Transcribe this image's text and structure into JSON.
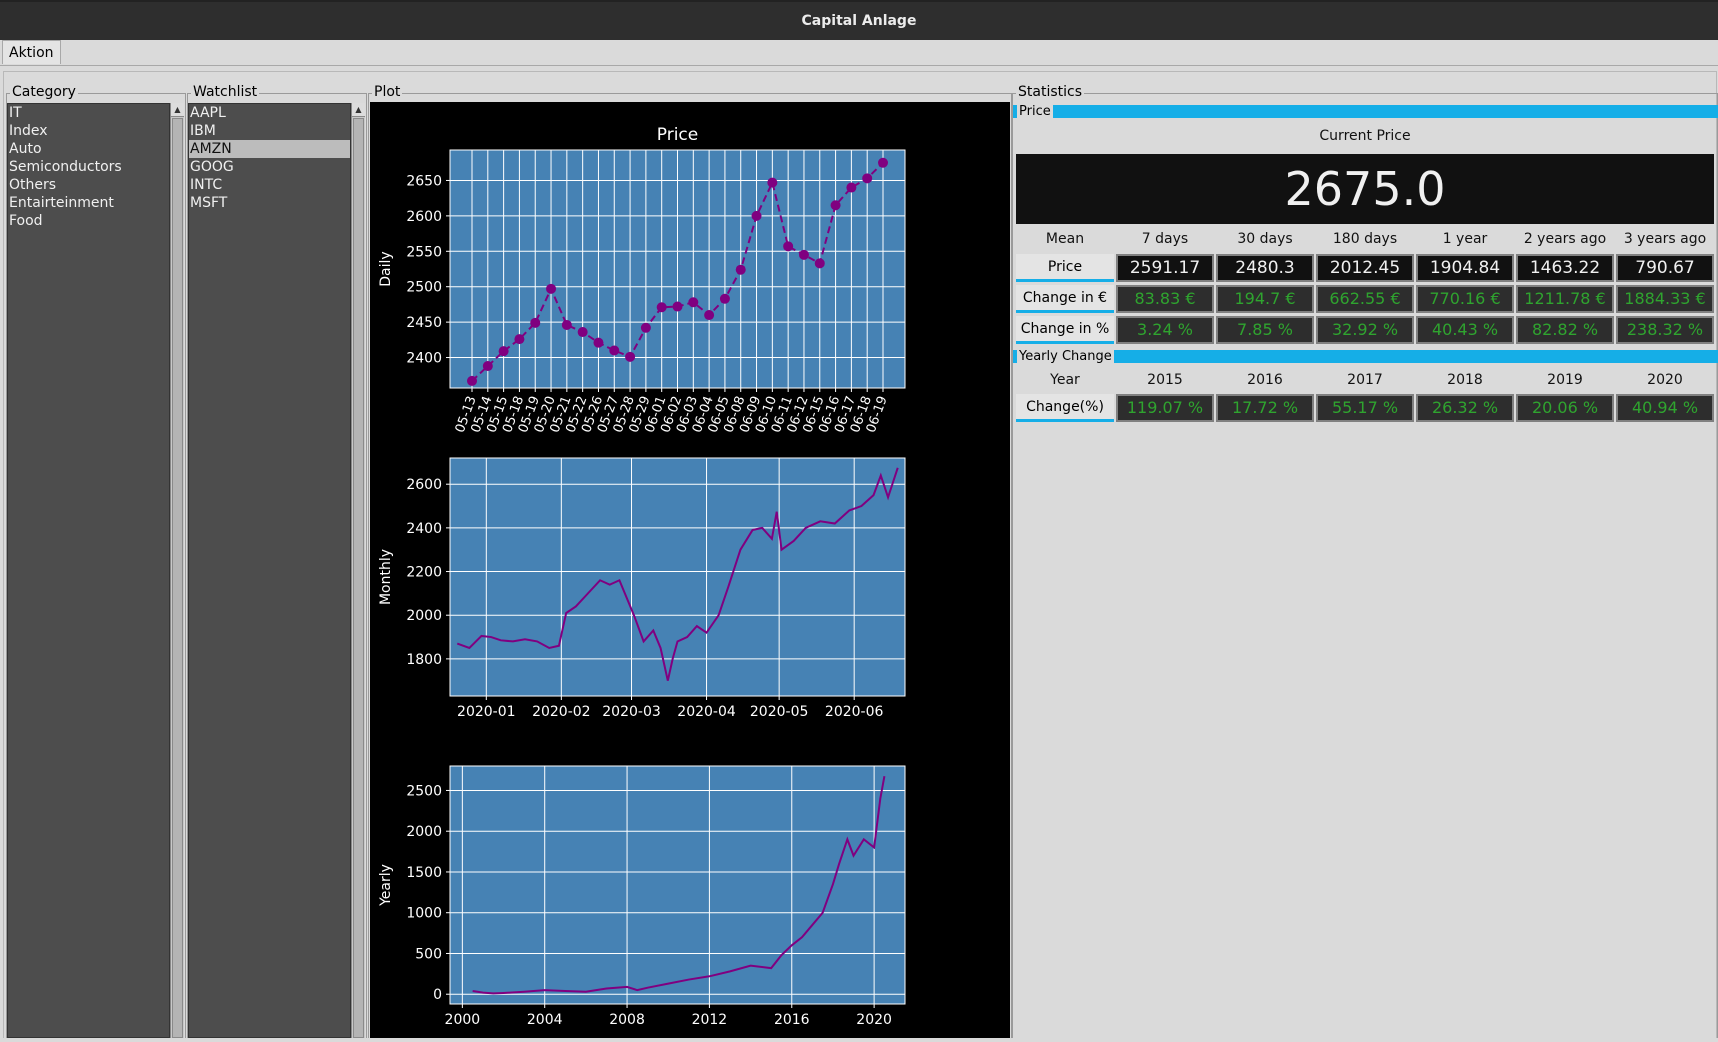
{
  "window": {
    "title": "Capital Anlage"
  },
  "tabs": [
    {
      "label": "Aktion"
    }
  ],
  "category": {
    "title": "Category",
    "items": [
      "IT",
      "Index",
      "Auto",
      "Semiconductors",
      "Others",
      "Entairteinment",
      "Food"
    ]
  },
  "watchlist": {
    "title": "Watchlist",
    "items": [
      "AAPL",
      "IBM",
      "AMZN",
      "GOOG",
      "INTC",
      "MSFT"
    ],
    "selected": "AMZN"
  },
  "plot": {
    "title": "Plot"
  },
  "statistics": {
    "title": "Statistics",
    "price_section": "Price",
    "current_price_label": "Current Price",
    "current_price": "2675.0",
    "headers": [
      "Mean",
      "7 days",
      "30 days",
      "180 days",
      "1 year",
      "2 years ago",
      "3 years ago"
    ],
    "rows": [
      {
        "label": "Price",
        "values": [
          "2591.17",
          "2480.3",
          "2012.45",
          "1904.84",
          "1463.22",
          "790.67"
        ]
      },
      {
        "label": "Change in €",
        "values": [
          "83.83 €",
          "194.7 €",
          "662.55 €",
          "770.16 €",
          "1211.78 €",
          "1884.33 €"
        ]
      },
      {
        "label": "Change in %",
        "values": [
          "3.24 %",
          "7.85 %",
          "32.92 %",
          "40.43 %",
          "82.82 %",
          "238.32 %"
        ]
      }
    ],
    "yearly_section": "Yearly Change",
    "yearly_headers": [
      "Year",
      "2015",
      "2016",
      "2017",
      "2018",
      "2019",
      "2020"
    ],
    "yearly_row": {
      "label": "Change(%)",
      "values": [
        "119.07 %",
        "17.72 %",
        "55.17 %",
        "26.32 %",
        "20.06 %",
        "40.94 %"
      ]
    }
  },
  "colors": {
    "accent": "#15aee7",
    "plot_bg": "#4682b4",
    "line": "#800080",
    "positive": "#2fa42f"
  },
  "chart_data": [
    {
      "type": "line",
      "title": "Price",
      "ylabel": "Daily",
      "categories": [
        "05-13",
        "05-14",
        "05-15",
        "05-18",
        "05-19",
        "05-20",
        "05-21",
        "05-22",
        "05-26",
        "05-27",
        "05-28",
        "05-29",
        "06-01",
        "06-02",
        "06-03",
        "06-04",
        "06-05",
        "06-08",
        "06-09",
        "06-10",
        "06-11",
        "06-12",
        "06-15",
        "06-16",
        "06-17",
        "06-18",
        "06-19"
      ],
      "values": [
        2367,
        2388,
        2409,
        2426,
        2449,
        2497,
        2446,
        2436,
        2421,
        2410,
        2401,
        2442,
        2471,
        2472,
        2478,
        2460,
        2483,
        2524,
        2600,
        2647,
        2557,
        2545,
        2533,
        2615,
        2640,
        2653,
        2675
      ],
      "ylim": [
        2357,
        2693
      ],
      "yticks": [
        2400,
        2450,
        2500,
        2550,
        2600,
        2650
      ],
      "grid": true
    },
    {
      "type": "line",
      "ylabel": "Monthly",
      "x": [
        "2019-12-20",
        "2019-12-25",
        "2019-12-30",
        "2020-01-03",
        "2020-01-07",
        "2020-01-12",
        "2020-01-17",
        "2020-01-22",
        "2020-01-27",
        "2020-01-31",
        "2020-02-03",
        "2020-02-07",
        "2020-02-12",
        "2020-02-17",
        "2020-02-21",
        "2020-02-25",
        "2020-03-02",
        "2020-03-06",
        "2020-03-10",
        "2020-03-13",
        "2020-03-16",
        "2020-03-18",
        "2020-03-20",
        "2020-03-24",
        "2020-03-28",
        "2020-04-01",
        "2020-04-06",
        "2020-04-10",
        "2020-04-15",
        "2020-04-20",
        "2020-04-24",
        "2020-04-28",
        "2020-04-30",
        "2020-05-02",
        "2020-05-07",
        "2020-05-12",
        "2020-05-18",
        "2020-05-24",
        "2020-05-30",
        "2020-06-04",
        "2020-06-09",
        "2020-06-12",
        "2020-06-15",
        "2020-06-19"
      ],
      "values": [
        1870,
        1850,
        1905,
        1900,
        1885,
        1880,
        1890,
        1880,
        1850,
        1860,
        2010,
        2040,
        2100,
        2160,
        2140,
        2160,
        2000,
        1880,
        1930,
        1850,
        1700,
        1800,
        1880,
        1900,
        1950,
        1920,
        2000,
        2130,
        2300,
        2390,
        2400,
        2350,
        2474,
        2300,
        2340,
        2400,
        2430,
        2420,
        2480,
        2500,
        2550,
        2640,
        2540,
        2675
      ],
      "xticks": [
        "2020-01",
        "2020-02",
        "2020-03",
        "2020-04",
        "2020-05",
        "2020-06"
      ],
      "ylim": [
        1630,
        2720
      ],
      "yticks": [
        1800,
        2000,
        2200,
        2400,
        2600
      ],
      "grid": true
    },
    {
      "type": "line",
      "ylabel": "Yearly",
      "x": [
        2000.5,
        2001,
        2001.5,
        2002,
        2003,
        2004,
        2005,
        2006,
        2007,
        2008,
        2008.5,
        2009,
        2010,
        2011,
        2012,
        2013,
        2014,
        2015,
        2015.5,
        2016,
        2016.5,
        2017,
        2017.5,
        2018,
        2018.3,
        2018.7,
        2019,
        2019.5,
        2020,
        2020.3,
        2020.5
      ],
      "values": [
        40,
        20,
        10,
        15,
        30,
        50,
        40,
        30,
        70,
        90,
        50,
        80,
        130,
        180,
        220,
        280,
        350,
        320,
        480,
        600,
        700,
        850,
        1000,
        1350,
        1600,
        1900,
        1700,
        1900,
        1800,
        2400,
        2675
      ],
      "xticks": [
        "2000",
        "2004",
        "2008",
        "2012",
        "2016",
        "2020"
      ],
      "ylim": [
        -120,
        2800
      ],
      "yticks": [
        0,
        500,
        1000,
        1500,
        2000,
        2500
      ],
      "grid": true
    }
  ]
}
